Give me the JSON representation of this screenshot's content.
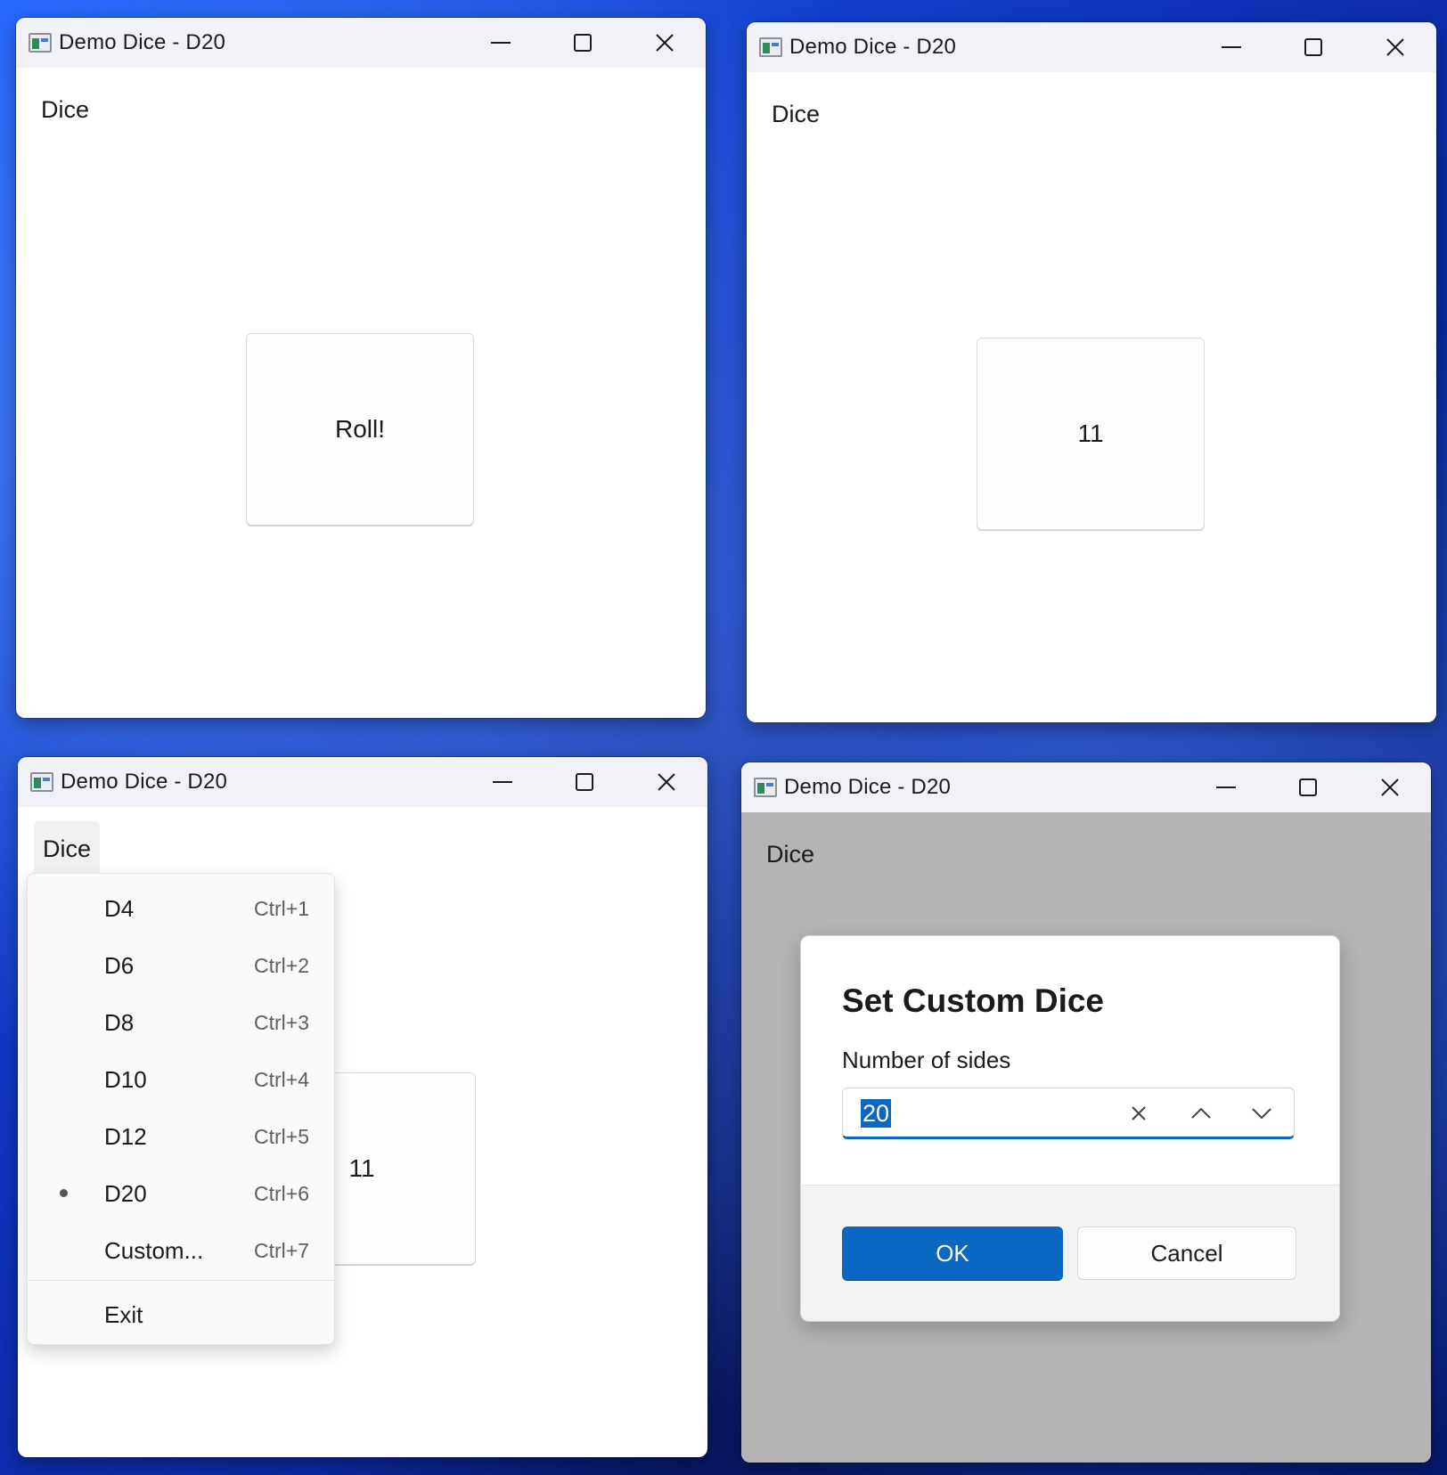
{
  "window_title": "Demo Dice - D20",
  "menu_label": "Dice",
  "panels": {
    "p1": {
      "button_text": "Roll!"
    },
    "p2": {
      "button_text": "11"
    },
    "p3": {
      "button_text": "11"
    }
  },
  "dice_menu": {
    "items": [
      {
        "label": "D4",
        "accel": "Ctrl+1",
        "checked": false
      },
      {
        "label": "D6",
        "accel": "Ctrl+2",
        "checked": false
      },
      {
        "label": "D8",
        "accel": "Ctrl+3",
        "checked": false
      },
      {
        "label": "D10",
        "accel": "Ctrl+4",
        "checked": false
      },
      {
        "label": "D12",
        "accel": "Ctrl+5",
        "checked": false
      },
      {
        "label": "D20",
        "accel": "Ctrl+6",
        "checked": true
      },
      {
        "label": "Custom...",
        "accel": "Ctrl+7",
        "checked": false
      }
    ],
    "exit_label": "Exit"
  },
  "dialog": {
    "title": "Set Custom Dice",
    "field_label": "Number of sides",
    "field_value": "20",
    "ok_label": "OK",
    "cancel_label": "Cancel"
  },
  "colors": {
    "accent": "#0a67c4",
    "dialog_overlay": "#b4b4b4",
    "titlebar": "#f0f2f7"
  },
  "icons": {
    "app": "app-window-icon",
    "minimize": "minimize-icon",
    "maximize": "maximize-icon",
    "close": "close-icon",
    "clear": "clear-icon",
    "up": "chevron-up-icon",
    "down": "chevron-down-icon"
  }
}
